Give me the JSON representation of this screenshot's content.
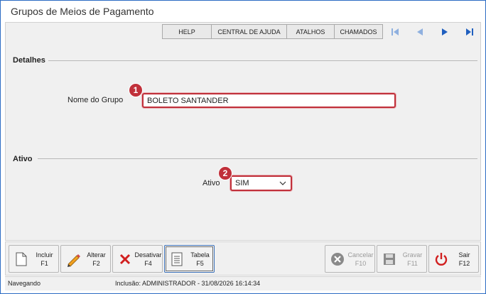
{
  "window": {
    "title": "Grupos de Meios de Pagamento"
  },
  "toolbar": {
    "help": "HELP",
    "central": "CENTRAL DE AJUDA",
    "atalhos": "ATALHOS",
    "chamados": "CHAMADOS",
    "nav_icons": [
      "first-record-icon",
      "previous-record-icon",
      "next-record-icon",
      "last-record-icon"
    ]
  },
  "detalhes": {
    "section_title": "Detalhes",
    "nome_label": "Nome do Grupo",
    "nome_value": "BOLETO SANTANDER",
    "marker": "1"
  },
  "ativo": {
    "section_title": "Ativo",
    "ativo_label": "Ativo",
    "ativo_value": "SIM",
    "marker": "2"
  },
  "actions": {
    "incluir": {
      "label": "Incluir",
      "key": "F1",
      "icon": "document-icon"
    },
    "alterar": {
      "label": "Alterar",
      "key": "F2",
      "icon": "pencil-icon"
    },
    "desativar": {
      "label": "Desativar",
      "key": "F4",
      "icon": "x-icon"
    },
    "tabela": {
      "label": "Tabela",
      "key": "F5",
      "icon": "table-icon"
    },
    "cancelar": {
      "label": "Cancelar",
      "key": "F10",
      "icon": "cancel-icon"
    },
    "gravar": {
      "label": "Gravar",
      "key": "F11",
      "icon": "save-icon"
    },
    "sair": {
      "label": "Sair",
      "key": "F12",
      "icon": "power-icon"
    }
  },
  "status": {
    "mode": "Navegando",
    "info": "Inclusão: ADMINISTRADOR - 31/08/2026 16:14:34"
  },
  "colors": {
    "accent": "#c0303a",
    "window_border": "#2b6cc4",
    "nav_blue": "#1f5fbf",
    "sair_red": "#d11f1f"
  }
}
